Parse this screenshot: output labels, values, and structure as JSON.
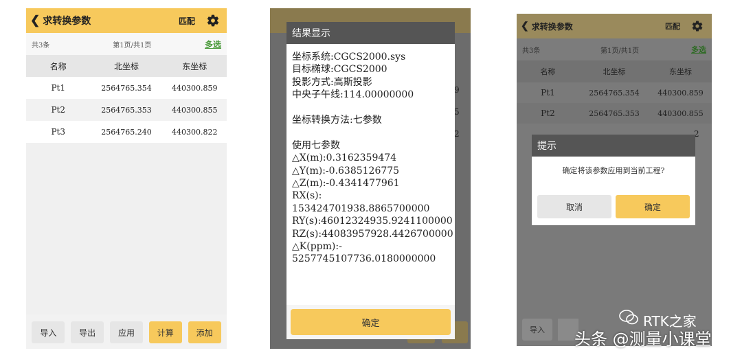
{
  "panel1": {
    "header": {
      "back_title": "求转换参数",
      "match_label": "匹配"
    },
    "info": {
      "count": "共3条",
      "page": "第1页/共1页",
      "multi_select": "多选"
    },
    "columns": [
      "名称",
      "北坐标",
      "东坐标"
    ],
    "rows": [
      {
        "name": "Pt1",
        "north": "2564765.354",
        "east": "440300.859"
      },
      {
        "name": "Pt2",
        "north": "2564765.353",
        "east": "440300.855"
      },
      {
        "name": "Pt3",
        "north": "2564765.240",
        "east": "440300.822"
      }
    ],
    "buttons": {
      "import": "导入",
      "export": "导出",
      "apply": "应用",
      "compute": "计算",
      "add": "添加"
    }
  },
  "panel2": {
    "dialog_title": "结果显示",
    "lines": [
      "坐标系统:CGCS2000.sys",
      "目标椭球:CGCS2000",
      "投影方式:高斯投影",
      "中央子午线:114.00000000",
      "",
      "坐标转换方法:七参数",
      "",
      "使用七参数",
      "△X(m):0.3162359474",
      "△Y(m):-0.6385126775",
      "△Z(m):-0.4341477961",
      "RX(s):",
      "153424701938.8865700000",
      "RY(s):46012324935.9241100000",
      "RZ(s):44083957928.4426700000",
      "△K(ppm):-",
      "5257745107736.0180000000"
    ],
    "ok_label": "确定",
    "peek_digits": [
      "9",
      "5",
      "2"
    ]
  },
  "panel3": {
    "header": {
      "back_title": "求转换参数",
      "match_label": "匹配"
    },
    "info": {
      "count": "共3条",
      "page": "第1页/共1页",
      "multi_select": "多选"
    },
    "columns": [
      "名称",
      "北坐标",
      "东坐标"
    ],
    "rows": [
      {
        "name": "Pt1",
        "north": "2564765.354",
        "east": "440300.859"
      },
      {
        "name": "Pt2",
        "north": "2564765.353",
        "east": "440300.855"
      }
    ],
    "peek_digit": "2",
    "buttons": {
      "import": "导入"
    },
    "prompt": {
      "title": "提示",
      "message": "确定将该参数应用到当前工程?",
      "cancel": "取消",
      "confirm": "确定"
    }
  },
  "watermarks": {
    "rtk": "RTK之家",
    "toutiao": "头条 @测量小课堂"
  },
  "colors": {
    "accent": "#f7c95c",
    "link_green": "#4a9a3a",
    "dialog_title_bg": "#555555"
  }
}
